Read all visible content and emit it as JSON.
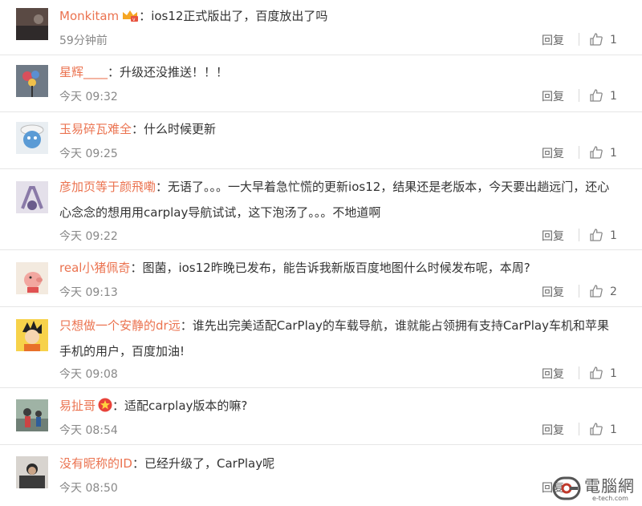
{
  "reply_label": "回复",
  "comments": [
    {
      "user": "Monkitam",
      "text": "ios12正式版出了，百度放出了吗",
      "time": "59分钟前",
      "likes": "1",
      "badge": "crown-vip-icon"
    },
    {
      "user": "星辉____",
      "text": "升级还没推送！！！",
      "time": "今天 09:32",
      "likes": "1"
    },
    {
      "user": "玉易碎瓦难全",
      "text": "什么时候更新",
      "time": "今天 09:25",
      "likes": "1"
    },
    {
      "user": "彦加页等于颜飛嘞",
      "text": "无语了。。。一大早着急忙慌的更新ios12，结果还是老版本，今天要出趟远门，还心心念念的想用用carplay导航试试，这下泡汤了。。。不地道啊",
      "time": "今天 09:22",
      "likes": "1"
    },
    {
      "user": "real小猪佩奇",
      "text": "图菌，ios12昨晚已发布，能告诉我新版百度地图什么时候发布呢，本周?",
      "time": "今天 09:13",
      "likes": "2"
    },
    {
      "user": "只想做一个安静的dr远",
      "text": "谁先出完美适配CarPlay的车载导航，谁就能占领拥有支持CarPlay车机和苹果手机的用户，百度加油!",
      "time": "今天 09:08",
      "likes": "1"
    },
    {
      "user": "易扯哥",
      "text": "适配carplay版本的嘛?",
      "time": "今天 08:54",
      "likes": "1",
      "badge": "star-badge-icon"
    },
    {
      "user": "没有昵称的ID",
      "text": "已经升级了，CarPlay呢",
      "time": "今天 08:50",
      "likes": ""
    }
  ],
  "watermark": {
    "main": "電腦網",
    "sub": "e-tech.com"
  },
  "colors": {
    "username": "#eb7350",
    "text": "#333333",
    "meta": "#888888"
  }
}
